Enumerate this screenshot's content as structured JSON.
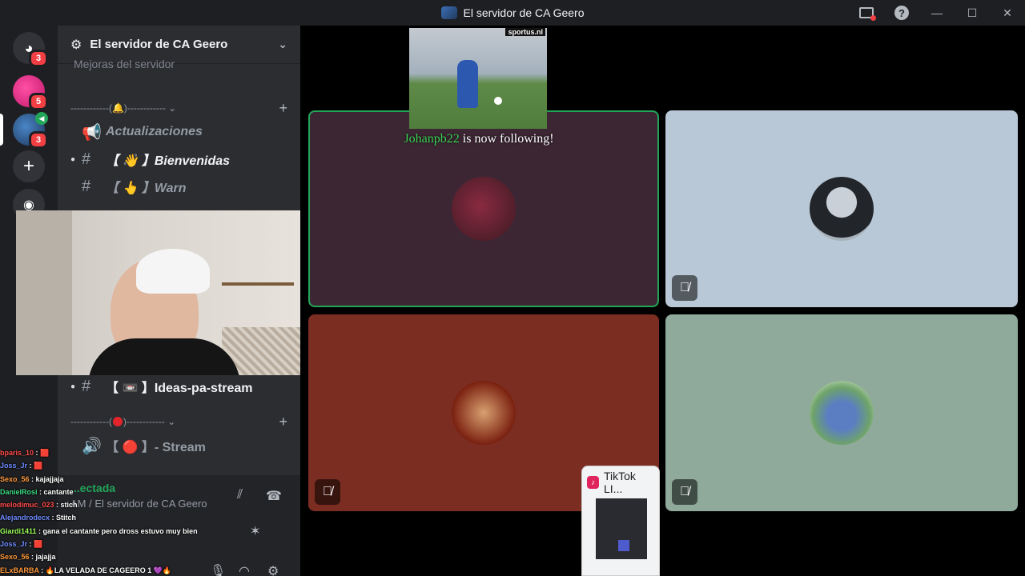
{
  "window": {
    "title": "El servidor de CA Geero"
  },
  "rail": {
    "home_badge": "3",
    "server1_badge": "5",
    "server2_badge": "3"
  },
  "sidebar": {
    "server_name": "El servidor de CA Geero",
    "boosts": "Mejoras del servidor",
    "categories": [
      {
        "label": "------------(🔔)------------ ⌄"
      },
      {
        "label": "------------(",
        "label_after": ")------------ ⌄"
      }
    ],
    "channels": [
      {
        "prefix": "📢",
        "name": "Actualizaciones"
      },
      {
        "prefix": "#",
        "name": "【 👋 】Bienvenidas"
      },
      {
        "prefix": "#",
        "name": "【 👆 】Warn"
      },
      {
        "prefix": "#",
        "name": "【 📼 】Ideas-pa-stream"
      },
      {
        "prefix": "🔊",
        "name": "【 🔴 】- Stream"
      }
    ]
  },
  "voice_panel": {
    "status": "...ectada",
    "location": "AM / El servidor de CA Geero"
  },
  "chat": [
    {
      "user": "bparis_10",
      "color": "#ff4d4d",
      "msg": "🟥"
    },
    {
      "user": "Joss_Jr",
      "color": "#6f8cff",
      "msg": "🟥"
    },
    {
      "user": "Sexo_56",
      "color": "#ff9a3d",
      "msg": "kajajjaja"
    },
    {
      "user": "DanielRosi",
      "color": "#3ddc84",
      "msg": "cantante"
    },
    {
      "user": "melodimuc_023",
      "color": "#ff4d4d",
      "msg": "stich"
    },
    {
      "user": "Alejandrodecx",
      "color": "#6f8cff",
      "msg": "Stitch"
    },
    {
      "user": "Giardi1411",
      "color": "#9cff5a",
      "msg": "gana el cantante pero dross estuvo muy bien"
    },
    {
      "user": "Joss_Jr",
      "color": "#6f8cff",
      "msg": "🟥"
    },
    {
      "user": "Sexo_56",
      "color": "#ff9a3d",
      "msg": "jajajja"
    },
    {
      "user": "ELxBARBA",
      "color": "#ff9a3d",
      "msg": "🔥LA VELADA DE CAGEERO 1 💜🔥"
    }
  ],
  "alert": {
    "image_brand": "sportus.nl",
    "follower": "Johanpb22",
    "message": " is now following!"
  },
  "tiktok": {
    "label": "TikTok LI..."
  },
  "colors": {
    "speaking_border": "#23a559",
    "tile1": "#3d2634",
    "tile2": "#b9c8d6",
    "tile3": "#7c2d22",
    "tile4": "#8faa9b"
  }
}
